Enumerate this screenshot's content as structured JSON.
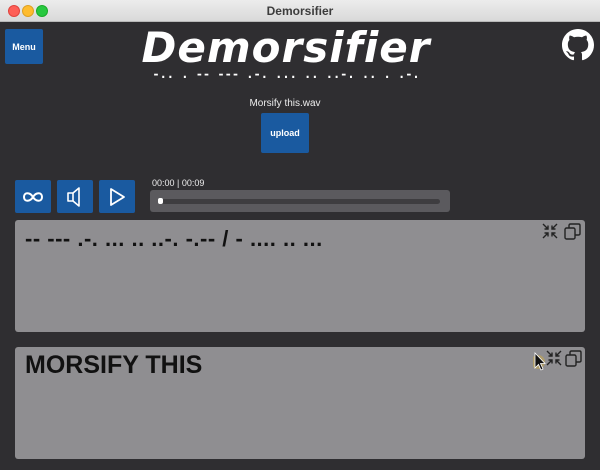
{
  "window": {
    "title": "Demorsifier"
  },
  "header": {
    "menu_label": "Menu",
    "logo_text": "Demorsifier",
    "logo_morse": "-.. . -- --- .-. ... .. ..-. .. . .-.",
    "github_icon": "github-icon"
  },
  "upload": {
    "filename": "Morsify this.wav",
    "button_label": "upload"
  },
  "player": {
    "controls": [
      "loop-icon",
      "volume-icon",
      "play-icon"
    ],
    "time": "00:00 | 00:09",
    "progress_fraction": 0.0
  },
  "morse_panel": {
    "text": "-- --- .-. ... .. ..-. -.-- / - .... .. ...",
    "icons": [
      "collapse-icon",
      "copy-icon"
    ]
  },
  "text_panel": {
    "text": "MORSIFY THIS",
    "icons": [
      "collapse-icon",
      "copy-icon"
    ]
  },
  "colors": {
    "background": "#2f2e31",
    "accent": "#1a5aa0",
    "panel": "#8f8e91",
    "progress_box": "#5b5a5e"
  }
}
